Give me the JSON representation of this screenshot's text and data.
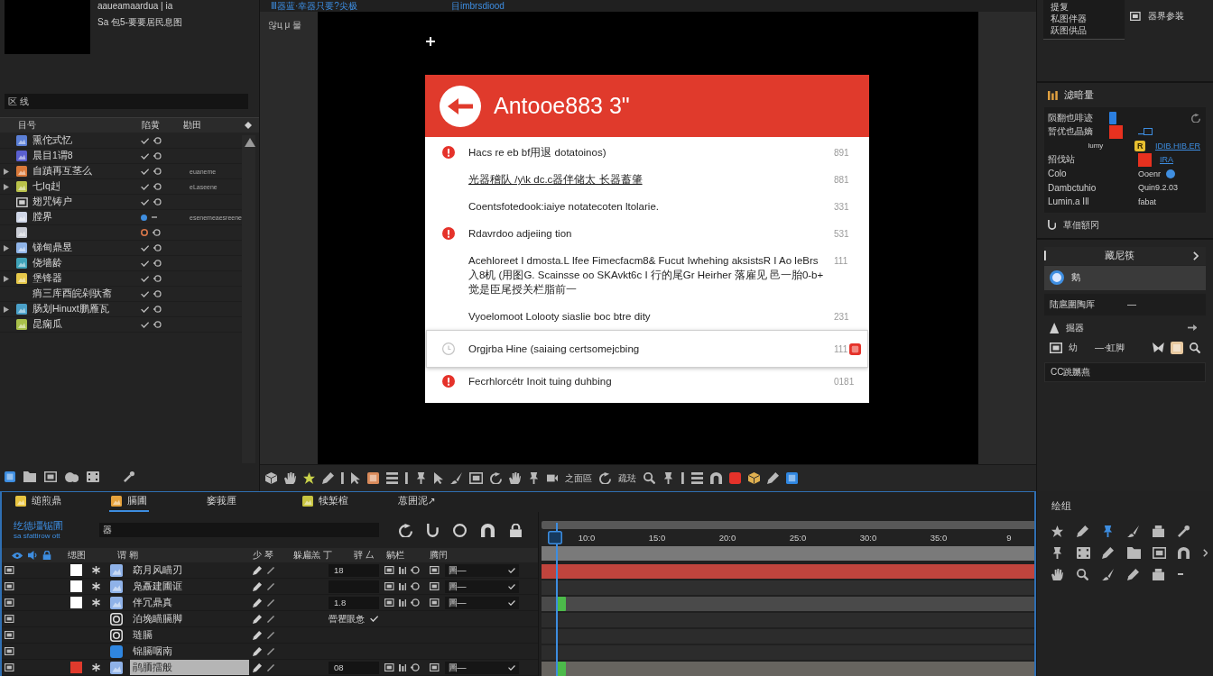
{
  "project": {
    "info": [
      "aaueamaardua | ia",
      "Sa 包5-要要居民息图"
    ],
    "search": {
      "value": "区 线"
    },
    "columns": [
      "目号",
      "陷黄",
      "勘田"
    ],
    "items": [
      {
        "name": "熏佗式忆",
        "kind": "file",
        "color": "#5b7fd6",
        "expandable": false
      },
      {
        "name": "晨目1谓8",
        "kind": "file",
        "color": "#5a5fd0",
        "expandable": false
      },
      {
        "name": "自蹟再互茎么",
        "kind": "file",
        "color": "#d9793a",
        "expandable": true,
        "size": "euaneme"
      },
      {
        "name": "七Iq赳",
        "kind": "file",
        "color": "#b9c24a",
        "expandable": true,
        "size": "eLaseene"
      },
      {
        "name": "翅咒铸户",
        "kind": "comp",
        "expandable": false
      },
      {
        "name": "膛界",
        "kind": "linked",
        "color": "#cfd6e6",
        "expandable": false,
        "size": "esenemeaesreene"
      },
      {
        "kind": "offline",
        "color": "#c9ccd4",
        "expandable": false
      },
      {
        "name": "锑甸鼎昱",
        "kind": "file",
        "color": "#8fb4e8",
        "expandable": true
      },
      {
        "name": "侥墙龄",
        "kind": "file",
        "color": "#3fa3b8",
        "expandable": false
      },
      {
        "name": "堡锋器",
        "kind": "file",
        "color": "#e6c84a",
        "expandable": true
      },
      {
        "name": "痟三库酉皖剁驮斋",
        "kind": "text",
        "expandable": false
      },
      {
        "name": "肠划Hinuxt鹏雁瓦",
        "kind": "file",
        "color": "#4aa0c8",
        "expandable": true
      },
      {
        "name": "昆痫瓜",
        "kind": "file",
        "color": "#a8c04a",
        "expandable": false
      }
    ]
  },
  "viewer": {
    "tabs": [
      "Ⅲ器蓝·幸器只要?尖极",
      "目imbrsdiood"
    ],
    "side_label": "않ц μ 물",
    "dialog": {
      "title": "Antooe883 3\"",
      "rows": [
        {
          "kind": "alert",
          "text": "Hacs re eb bf用退 dotatoinos)",
          "value": "891",
          "selected": false,
          "flagged": false
        },
        {
          "kind": "link",
          "text": "光器稽队 /y\\k dc.c器伴储太 长器蓄肇",
          "value": "881",
          "selected": false,
          "flagged": false
        },
        {
          "kind": "plain",
          "text": "Coentsfotedook:iaiye notatecoten ltolarie.",
          "value": "331",
          "selected": false,
          "flagged": false
        },
        {
          "kind": "alert",
          "text": "Rdavrdoo adjeiing tion",
          "value": "531",
          "selected": false,
          "flagged": false
        },
        {
          "kind": "plain",
          "text": "Acehloreet I dmosta.L Ifee Fimecfacm8& Fucut Iwhehing aksistsR I Ao leBrs 入8机 (用图G. Scainsse oo SKAvkt6c I 行的尾Gr Heirher 落雇见 邑一胎0-b+ 觉是臣尾授关栏脂前一",
          "value": "111",
          "selected": false,
          "flagged": false
        },
        {
          "kind": "plain",
          "text": "Vyoelomoot Lolooty siaslie boc btre dity",
          "value": "231",
          "selected": false,
          "flagged": false
        },
        {
          "kind": "pending",
          "text": "Orgjrba Hine (saiaing certsomejcbing",
          "value": "111",
          "selected": true,
          "flagged": true
        },
        {
          "kind": "alert",
          "text": "Fecrhlorcétr Inoit tuing duhbing",
          "value": "0181",
          "selected": false,
          "flagged": false
        }
      ]
    },
    "toolbar_labels": [
      "之面區",
      "疏珐"
    ]
  },
  "side": {
    "recent": [
      "提复",
      "私图伴器",
      "跃图供品"
    ],
    "view_label": "器界参装",
    "effect": {
      "title": "滤暗量",
      "properties": [
        {
          "label": "陨翻也啡迹",
          "kind": "color",
          "color": "#2b7fe0"
        },
        {
          "label": "暂优也晶嫡",
          "kind": "color-linked",
          "color": "#e8311f"
        },
        {
          "label": "lumy",
          "kind": "link",
          "badge": "R",
          "link": "IDIB.HIB.ER"
        },
        {
          "label": "招伐站",
          "kind": "color-link",
          "color": "#e8311f",
          "link": "IRA"
        },
        {
          "label": "Colo",
          "kind": "option",
          "value": "Ooenr"
        },
        {
          "label": "Dambctuhio",
          "kind": "text",
          "value": "Quin9.2.03"
        },
        {
          "label": "Lumin.a Ill",
          "kind": "text",
          "value": "fabat"
        }
      ],
      "footer": "草佃額冈"
    },
    "panel": {
      "title": "藏尼筷",
      "items": [
        {
          "kind": "radio",
          "label": "鹅",
          "selected": true
        },
        {
          "kind": "value",
          "label": "陆扈圍陶厍",
          "value": "—",
          "selected": false
        },
        {
          "kind": "group",
          "label": "掘器",
          "selected": false
        }
      ],
      "controls": {
        "label": "幼",
        "value": "—·虹脚"
      },
      "field": {
        "value": "CC跳嬲燕"
      }
    }
  },
  "timeline": {
    "tabs": [
      {
        "label": "缒煎鼎",
        "color": "#e8c440",
        "selected": false
      },
      {
        "label": "膈圃",
        "color": "#e6a23c",
        "selected": true
      },
      {
        "label": "窭莪厘",
        "selected": false
      },
      {
        "label": "犊椠楦",
        "color": "#c8c440",
        "selected": false
      },
      {
        "label": "葸囲泥↗",
        "selected": false
      }
    ],
    "comp": {
      "name": "纥德壃锯圊",
      "subtitle": "sa sfattirow ott"
    },
    "search": {
      "value": "器"
    },
    "columns": [
      "缌图",
      "谓 翱",
      "少 琴",
      "躲扁羔 丁",
      "骍 厶",
      "鹟栏",
      "腾闬"
    ],
    "layers": [
      {
        "name": "窈月风瞄刃",
        "kind": "footage",
        "color": "#ffffff",
        "mode": "18",
        "parent": "圖—",
        "selected": false
      },
      {
        "name": "凫矗建圃诓",
        "kind": "footage",
        "color": "#ffffff",
        "parent": "圖—",
        "selected": false
      },
      {
        "name": "伴冗鼎真",
        "kind": "footage",
        "color": "#ffffff",
        "mode": "1.8",
        "parent": "圖—",
        "selected": false
      },
      {
        "name": "泊堍瞄膈脚",
        "kind": "shape",
        "mode": "罾瞿眼惫",
        "selected": false
      },
      {
        "name": "琏膈",
        "kind": "shape",
        "selected": false
      },
      {
        "name": "锦膈咽南",
        "kind": "solid",
        "selected": false
      },
      {
        "name": "鹃胹擂般",
        "kind": "footage",
        "color": "#e03a2c",
        "mode": "08",
        "parent": "圖—",
        "selected": true
      }
    ],
    "ruler": [
      "10:0",
      "15:0",
      "20:0",
      "25:0",
      "30:0",
      "35:0",
      "9"
    ],
    "tracks": [
      {
        "color": "#c0443d",
        "keyframe": false
      },
      {
        "color": "#2f2f2f",
        "keyframe": false
      },
      {
        "color": "#4a4a4a",
        "keyframe": true
      },
      {
        "color": "#2c2c2c",
        "keyframe": false
      },
      {
        "color": "#2c2c2c",
        "keyframe": false
      },
      {
        "color": "#2c2c2c",
        "keyframe": false
      },
      {
        "color": "#67645f",
        "keyframe": true
      }
    ]
  },
  "tools": {
    "title": "绘组"
  }
}
